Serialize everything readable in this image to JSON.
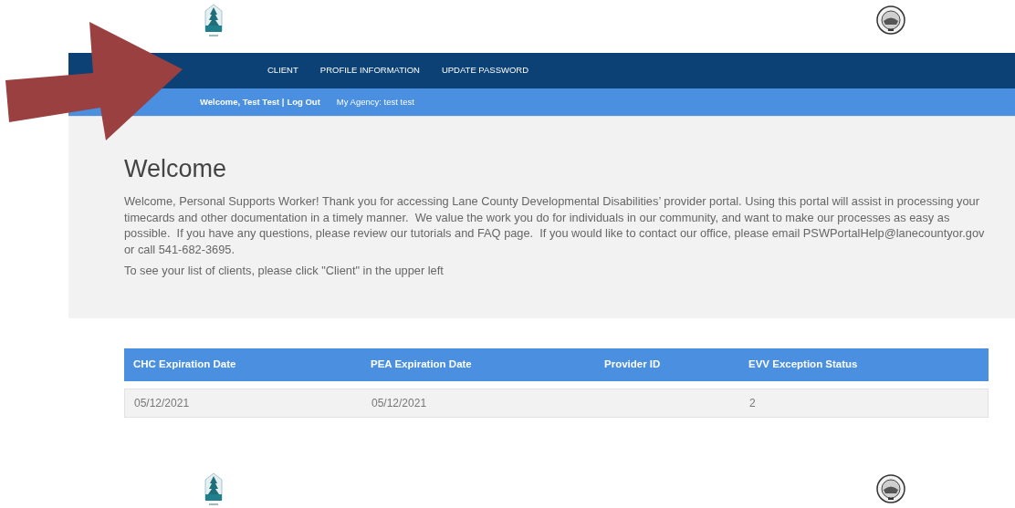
{
  "nav": {
    "items": [
      {
        "label": "CLIENT"
      },
      {
        "label": "PROFILE INFORMATION"
      },
      {
        "label": "UPDATE PASSWORD"
      }
    ]
  },
  "user_bar": {
    "welcome": "Welcome, Test Test |",
    "logout": "Log Out",
    "agency": "My Agency: test test"
  },
  "intro": {
    "title": "Welcome",
    "paragraphs": [
      "Welcome, Personal Supports Worker! Thank you for accessing Lane County Developmental Disabilities’ provider portal. Using this portal will assist in processing your timecards and other documentation in a timely manner.  We value the work you do for individuals in our community, and want to make our processes as easy as possible.  If you have any questions, please review our tutorials and FAQ page.  If you would like to contact our office, please email PSWPortalHelp@lanecountyor.gov or call 541-682-3695.",
      "To see your list of clients, please click \"Client\" in the upper left"
    ]
  },
  "table": {
    "columns": [
      "CHC Expiration Date",
      "PEA Expiration Date",
      "Provider ID",
      "EVV Exception Status"
    ],
    "rows": [
      {
        "cells": [
          "05/12/2021",
          "05/12/2021",
          "",
          "2"
        ]
      }
    ]
  }
}
